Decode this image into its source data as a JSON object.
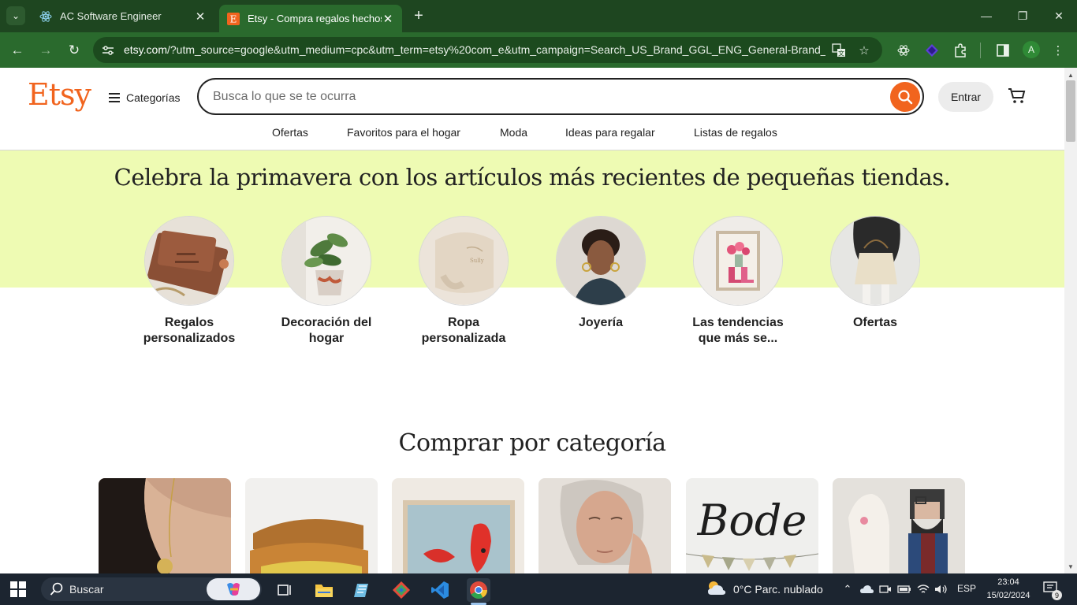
{
  "browser": {
    "tabs": [
      {
        "title": "AC Software Engineer",
        "icon": "react-icon"
      },
      {
        "title": "Etsy - Compra regalos hechos a mano",
        "icon": "etsy-icon"
      }
    ],
    "url_host": "etsy.com",
    "url_rest": "/?utm_source=google&utm_medium=cpc&utm_term=etsy%20com_e&utm_campaign=Search_US_Brand_GGL_ENG_General-Brand_C...",
    "profile_initial": "A"
  },
  "header": {
    "logo": "Etsy",
    "categories_label": "Categorías",
    "search_placeholder": "Busca lo que se te ocurra",
    "signin_label": "Entrar",
    "nav_links": [
      "Ofertas",
      "Favoritos para el hogar",
      "Moda",
      "Ideas para regalar",
      "Listas de regalos"
    ]
  },
  "hero": {
    "title": "Celebra la primavera con los artículos más recientes de pequeñas tiendas.",
    "items": [
      {
        "label": "Regalos personalizados"
      },
      {
        "label": "Decoración del hogar"
      },
      {
        "label": "Ropa personalizada"
      },
      {
        "label": "Joyería"
      },
      {
        "label": "Las tendencias que más se..."
      },
      {
        "label": "Ofertas"
      }
    ]
  },
  "categories_section": {
    "title": "Comprar por categoría",
    "sign_text": "Bode"
  },
  "taskbar": {
    "search_label": "Buscar",
    "weather": "0°C  Parc. nublado",
    "language": "ESP",
    "time": "23:04",
    "date": "15/02/2024",
    "notifications": "9"
  },
  "colors": {
    "etsy_orange": "#f1641e",
    "hero_band": "#eefbb3",
    "browser_frame": "#2a6a2d"
  }
}
